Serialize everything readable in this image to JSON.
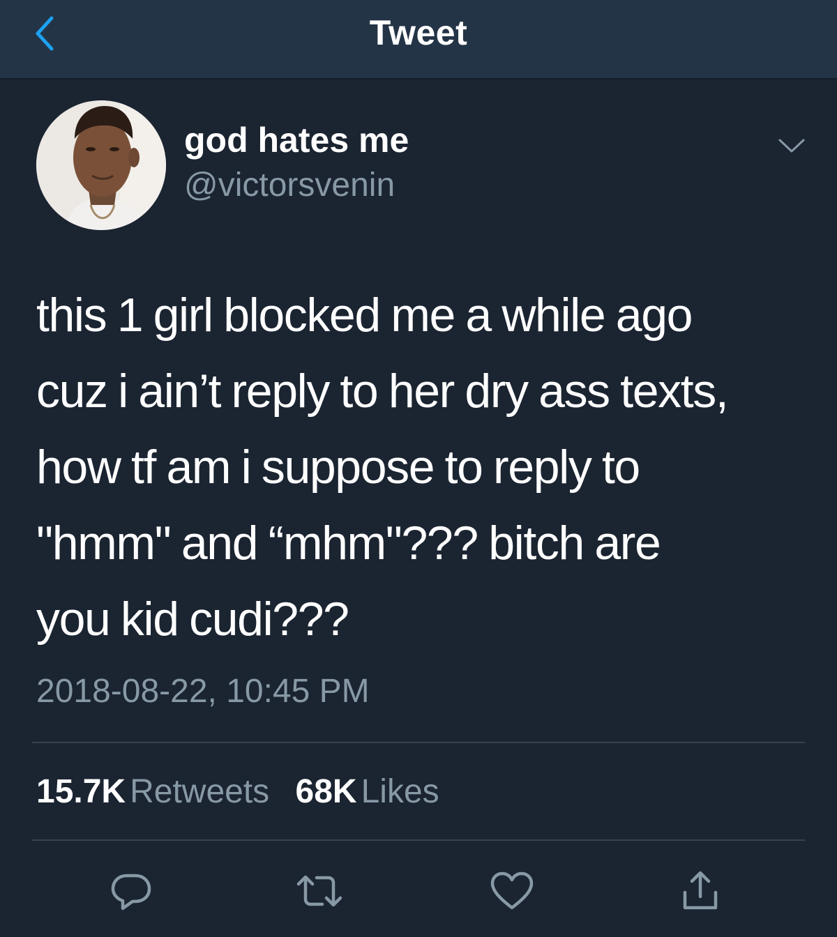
{
  "navbar": {
    "title": "Tweet",
    "back_icon": "chevron-left-icon",
    "accent_color": "#1da1f2"
  },
  "user": {
    "display_name": "god hates me",
    "handle": "@victorsvenin",
    "menu_icon": "chevron-down-icon"
  },
  "tweet": {
    "lines": [
      "this 1 girl blocked me a while ago",
      "cuz i ain’t reply to her dry ass texts,",
      "how tf am i suppose to reply to",
      "\"hmm\" and “mhm\"??? bitch are",
      "you kid cudi???"
    ],
    "timestamp": "2018-08-22, 10:45 PM"
  },
  "stats": {
    "retweets_count": "15.7K",
    "retweets_label": "Retweets",
    "likes_count": "68K",
    "likes_label": "Likes"
  },
  "actions": {
    "reply_icon": "reply-icon",
    "retweet_icon": "retweet-icon",
    "like_icon": "heart-icon",
    "share_icon": "share-icon"
  },
  "colors": {
    "background": "#1b2431",
    "navbar": "#243447",
    "secondary_text": "#8899a6",
    "divider": "#38444d"
  }
}
